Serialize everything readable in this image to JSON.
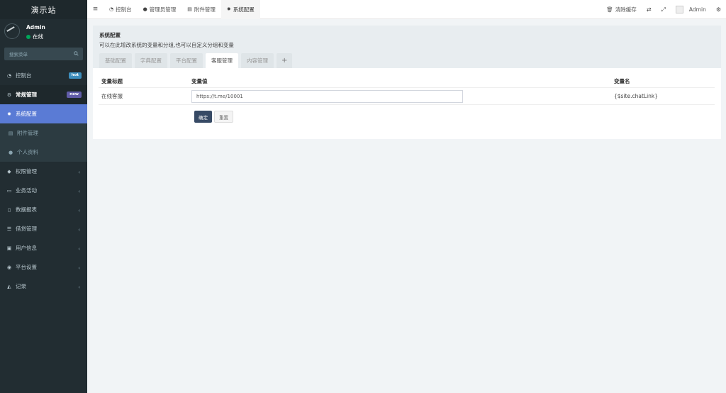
{
  "sidebar": {
    "logo": "演示站",
    "user": {
      "name": "Admin",
      "status": "在线"
    },
    "search_placeholder": "搜索菜单",
    "items": [
      {
        "label": "控制台",
        "badge": "hot"
      },
      {
        "label": "常规管理",
        "badge": "new"
      },
      {
        "label": "系统配置"
      },
      {
        "label": "附件管理"
      },
      {
        "label": "个人资料"
      },
      {
        "label": "权限管理"
      },
      {
        "label": "业务活动"
      },
      {
        "label": "数据报表"
      },
      {
        "label": "借贷管理"
      },
      {
        "label": "用户信息"
      },
      {
        "label": "平台设置"
      },
      {
        "label": "记录"
      }
    ]
  },
  "topbar": {
    "tabs": [
      {
        "label": "控制台"
      },
      {
        "label": "管理员管理"
      },
      {
        "label": "附件管理"
      },
      {
        "label": "系统配置"
      }
    ],
    "clear_cache": "清除缓存",
    "user": "Admin"
  },
  "panel": {
    "title": "系统配置",
    "description": "可以在此增改系统的变量和分组,也可以自定义分组和变量",
    "tabs": [
      {
        "label": "基础配置"
      },
      {
        "label": "字典配置"
      },
      {
        "label": "平台配置"
      },
      {
        "label": "客服管理"
      },
      {
        "label": "内容管理"
      }
    ],
    "add_tab": "+",
    "table": {
      "headers": [
        "变量标题",
        "变量值",
        "变量名"
      ],
      "rows": [
        {
          "title": "在线客服",
          "value": "https://t.me/10001",
          "name": "{$site.chatLink}"
        }
      ]
    },
    "submit_label": "确定",
    "reset_label": "重置"
  }
}
